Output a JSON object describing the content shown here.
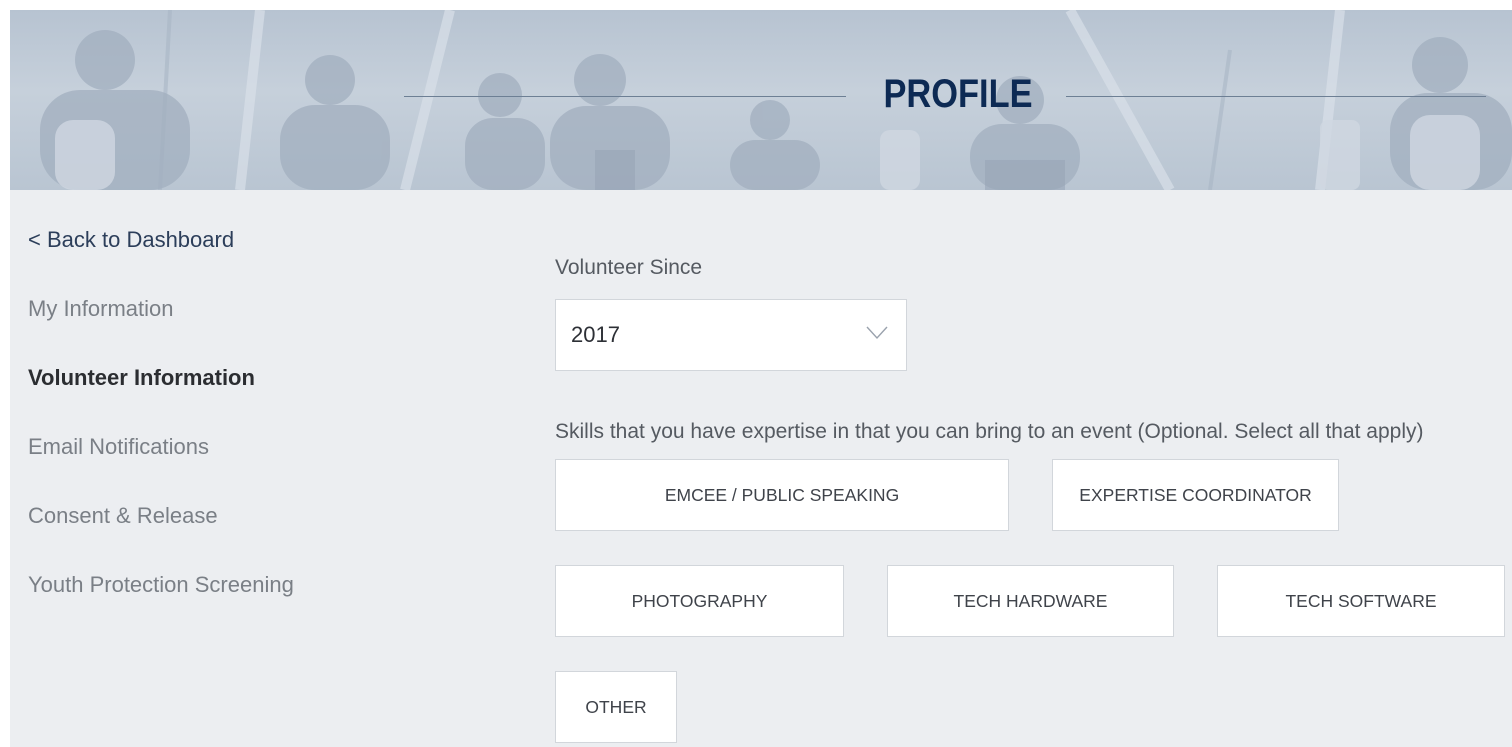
{
  "banner": {
    "title": "PROFILE"
  },
  "sidebar": {
    "items": [
      {
        "label": "< Back to Dashboard",
        "state": "link"
      },
      {
        "label": "My Information",
        "state": "normal"
      },
      {
        "label": "Volunteer Information",
        "state": "active"
      },
      {
        "label": "Email Notifications",
        "state": "normal"
      },
      {
        "label": "Consent & Release",
        "state": "normal"
      },
      {
        "label": "Youth Protection Screening",
        "state": "normal"
      }
    ]
  },
  "main": {
    "volunteer_since": {
      "label": "Volunteer Since",
      "selected": "2017",
      "icon": "chevron-down-icon"
    },
    "skills": {
      "prompt": "Skills that you have expertise in that you can bring to an event (Optional. Select all that apply)",
      "options": [
        "EMCEE / PUBLIC SPEAKING",
        "EXPERTISE COORDINATOR",
        "PHOTOGRAPHY",
        "TECH HARDWARE",
        "TECH SOFTWARE",
        "OTHER"
      ]
    }
  },
  "colors": {
    "page_background": "#eceef1",
    "banner_tint": "#c1ccd8",
    "title": "#0d2a54",
    "link": "#2c3e5a",
    "muted_text": "#7a7f86",
    "button_border": "#d2d6db"
  }
}
